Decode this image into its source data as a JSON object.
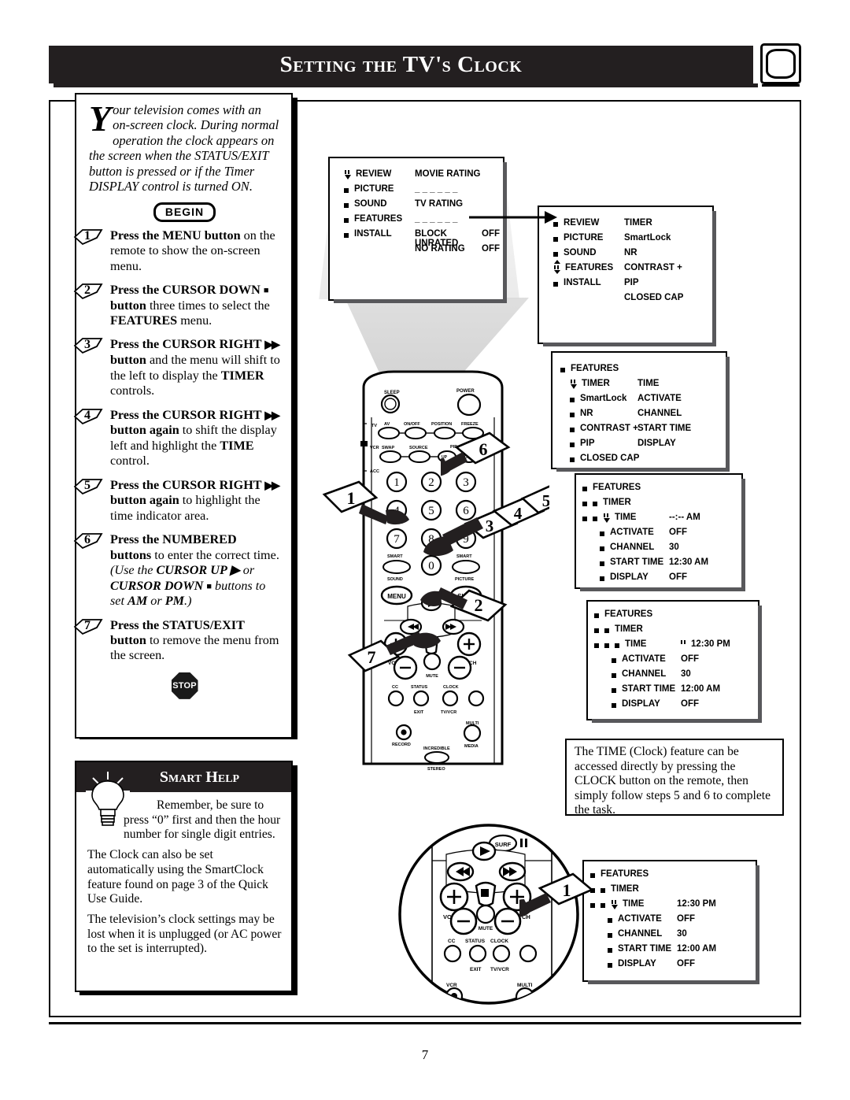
{
  "page": {
    "title": "Setting the TV's Clock",
    "number": "7",
    "tv_icon": "tv-screen-icon"
  },
  "intro": {
    "dropcap": "Y",
    "text": "our television comes with an on-screen clock. During normal operation the clock appears on the screen when the STATUS/EXIT button is pressed or if the Timer DISPLAY control is turned ON.",
    "begin_label": "BEGIN",
    "stop_label": "STOP"
  },
  "steps": [
    {
      "number": "1",
      "html": "<b>Press the MENU button</b> on the remote to show the on-screen menu."
    },
    {
      "number": "2",
      "html": "<b>Press the CURSOR DOWN <span class=\"sq\">&#9632;</span> button</b> three times to select the <b>FEATURES</b> menu."
    },
    {
      "number": "3",
      "html": "<b>Press the CURSOR RIGHT <span class=\"arrs\">&#9654;&#9654;</span> button</b> and the menu will shift to the left to display the <b>TIMER</b> controls."
    },
    {
      "number": "4",
      "html": "<b>Press the CURSOR RIGHT <span class=\"arrs\">&#9654;&#9654;</span> button again</b> to shift the display left and highlight the <b>TIME</b> control."
    },
    {
      "number": "5",
      "html": "<b>Press the CURSOR RIGHT <span class=\"arrs\">&#9654;&#9654;</span> button again</b> to highlight the time indicator area."
    },
    {
      "number": "6",
      "html": "<b>Press the NUMBERED buttons</b> to enter the correct time. <i>(Use the <b>CURSOR UP &#9654;</b> or <b>CURSOR DOWN <span class=\"sq\">&#9632;</span></b> buttons to set <b>AM</b> or <b>PM</b>.)</i>"
    },
    {
      "number": "7",
      "html": "<b>Press the STATUS/EXIT button</b> to remove the menu from the screen."
    }
  ],
  "smart_help": {
    "header": "Smart Help",
    "icon": "lightbulb-icon",
    "paragraphs": [
      "Remember, be sure to press “0” first and then the hour number for single digit entries.",
      "The Clock can also be set automatically using the SmartClock feature found on page 3 of the Quick Use Guide.",
      "The television’s clock settings may be lost when it is unplugged (or AC power to the set is interrupted)."
    ]
  },
  "note": {
    "text": "The TIME (Clock) feature can be accessed directly by pressing the CLOCK button on the remote, then simply follow steps 5 and 6 to complete the task."
  },
  "osd_menus": [
    {
      "id": "menu1",
      "name": "osd-menu-review",
      "left_items": [
        {
          "label": "REVIEW",
          "marker": "cursor"
        },
        {
          "label": "PICTURE",
          "marker": "bullet"
        },
        {
          "label": "SOUND",
          "marker": "bullet"
        },
        {
          "label": "FEATURES",
          "marker": "bullet"
        },
        {
          "label": "INSTALL",
          "marker": "bullet"
        }
      ],
      "right_items": [
        {
          "label": "MOVIE RATING",
          "value": ""
        },
        {
          "label": "_ _ _ _ _ _",
          "value": ""
        },
        {
          "label": "TV RATING",
          "value": ""
        },
        {
          "label": "_ _ _ _ _ _",
          "value": ""
        },
        {
          "label": "BLOCK UNRATED",
          "value": "OFF"
        },
        {
          "label": "NO RATING",
          "value": "OFF"
        }
      ]
    },
    {
      "id": "menu2",
      "name": "osd-menu-features",
      "left_items": [
        {
          "label": "REVIEW",
          "marker": "bullet"
        },
        {
          "label": "PICTURE",
          "marker": "bullet"
        },
        {
          "label": "SOUND",
          "marker": "bullet"
        },
        {
          "label": "FEATURES",
          "marker": "updown"
        },
        {
          "label": "INSTALL",
          "marker": "bullet"
        }
      ],
      "right_items": [
        {
          "label": "TIMER",
          "value": ""
        },
        {
          "label": "SmartLock",
          "value": ""
        },
        {
          "label": "NR",
          "value": ""
        },
        {
          "label": "CONTRAST +",
          "value": ""
        },
        {
          "label": "PIP",
          "value": ""
        },
        {
          "label": "CLOSED CAP",
          "value": ""
        }
      ]
    },
    {
      "id": "menu3",
      "name": "osd-menu-timer",
      "header": "FEATURES",
      "left_items": [
        {
          "label": "TIMER",
          "marker": "cursor"
        },
        {
          "label": "SmartLock",
          "marker": "bullet"
        },
        {
          "label": "NR",
          "marker": "bullet"
        },
        {
          "label": "CONTRAST +",
          "marker": "bullet"
        },
        {
          "label": "PIP",
          "marker": "bullet"
        },
        {
          "label": "CLOSED CAP",
          "marker": "bullet"
        }
      ],
      "right_items": [
        {
          "label": "TIME",
          "value": ""
        },
        {
          "label": "ACTIVATE",
          "value": ""
        },
        {
          "label": "CHANNEL",
          "value": ""
        },
        {
          "label": "START TIME",
          "value": ""
        },
        {
          "label": "DISPLAY",
          "value": ""
        }
      ]
    },
    {
      "id": "menu4",
      "name": "osd-menu-time-blank",
      "header": "FEATURES",
      "subheader": "TIMER",
      "rows": [
        {
          "label": "TIME",
          "value": "--:-- AM",
          "marker": "cursor"
        },
        {
          "label": "ACTIVATE",
          "value": "OFF",
          "marker": "bullet"
        },
        {
          "label": "CHANNEL",
          "value": "30",
          "marker": "bullet"
        },
        {
          "label": "START TIME",
          "value": "12:30 AM",
          "marker": "bullet"
        },
        {
          "label": "DISPLAY",
          "value": "OFF",
          "marker": "bullet"
        }
      ]
    },
    {
      "id": "menu5",
      "name": "osd-menu-time-set",
      "header": "FEATURES",
      "subheader": "TIMER",
      "rows": [
        {
          "label": "TIME",
          "value": "12:30 PM",
          "marker": "bullet",
          "value_marker": "bars"
        },
        {
          "label": "ACTIVATE",
          "value": "OFF",
          "marker": "bullet"
        },
        {
          "label": "CHANNEL",
          "value": "30",
          "marker": "bullet"
        },
        {
          "label": "START TIME",
          "value": "12:00 AM",
          "marker": "bullet"
        },
        {
          "label": "DISPLAY",
          "value": "OFF",
          "marker": "bullet"
        }
      ]
    },
    {
      "id": "menu6",
      "name": "osd-menu-clock-direct",
      "header": "FEATURES",
      "subheader": "TIMER",
      "rows": [
        {
          "label": "TIME",
          "value": "12:30 PM",
          "marker": "cursor"
        },
        {
          "label": "ACTIVATE",
          "value": "OFF",
          "marker": "bullet"
        },
        {
          "label": "CHANNEL",
          "value": "30",
          "marker": "bullet"
        },
        {
          "label": "START TIME",
          "value": "12:00 AM",
          "marker": "bullet"
        },
        {
          "label": "DISPLAY",
          "value": "OFF",
          "marker": "bullet"
        }
      ]
    }
  ],
  "remote": {
    "name": "tv-remote-control",
    "buttons": {
      "sleep": "SLEEP",
      "power": "POWER",
      "tv": "TV",
      "vcr": "VCR",
      "acc": "ACC",
      "av": "AV",
      "onoff": "ON/OFF",
      "position": "POSITION",
      "freeze": "FREEZE",
      "swap": "SWAP",
      "source": "SOURCE",
      "pipch": "PIP CH",
      "up": "UP",
      "ch_small": "CH",
      "num1": "1",
      "num2": "2",
      "num3": "3",
      "num4": "4",
      "num5": "5",
      "num6": "6",
      "num7": "7",
      "num8": "8",
      "num9": "9",
      "num0": "0",
      "smart_sound": "SMART SOUND",
      "smart_picture": "SMART PICTURE",
      "menu": "MENU",
      "surf": "SURF",
      "vol": "VOL",
      "ch": "CH",
      "mute": "MUTE",
      "cc": "CC",
      "status_exit": "STATUS EXIT",
      "clock_tvvcr": "CLOCK TV/VCR",
      "vcr_record": "VCR RECORD",
      "multi_media": "MULTI MEDIA",
      "incredible_stereo": "INCREDIBLE STEREO"
    },
    "callouts": [
      "1",
      "2",
      "3",
      "4",
      "5",
      "6",
      "7"
    ],
    "inset_callout": "1"
  }
}
